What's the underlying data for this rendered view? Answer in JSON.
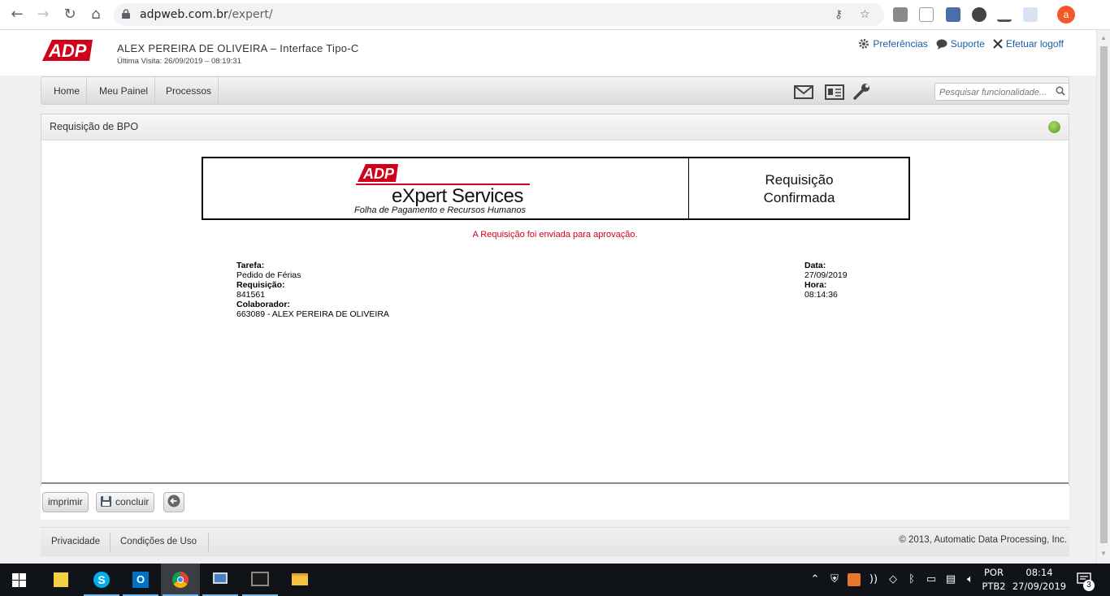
{
  "browser": {
    "url_domain": "adpweb.com.br",
    "url_path": "/expert/",
    "profile_initial": "a"
  },
  "header": {
    "user_line": "ALEX PEREIRA DE OLIVEIRA – Interface Tipo-C",
    "last_visit": "Última Visita: 26/09/2019 – 08:19:31",
    "links": {
      "preferences": "Preferências",
      "support": "Suporte",
      "logoff": "Efetuar logoff"
    }
  },
  "menu": {
    "items": [
      "Home",
      "Meu Painel",
      "Processos"
    ],
    "search_placeholder": "Pesquisar funcionalidade..."
  },
  "panel": {
    "title": "Requisição de BPO",
    "banner": {
      "brand": "eXpert Services",
      "subtitle": "Folha de Pagamento e Recursos Humanos",
      "status_line1": "Requisição",
      "status_line2": "Confirmada"
    },
    "message": "A Requisição foi enviada para aprovação.",
    "details": {
      "tarefa_label": "Tarefa:",
      "tarefa_value": "Pedido de Férias",
      "requisicao_label": "Requisição:",
      "requisicao_value": "841561",
      "colaborador_label": "Colaborador:",
      "colaborador_value": "663089 - ALEX PEREIRA DE OLIVEIRA",
      "data_label": "Data:",
      "data_value": "27/09/2019",
      "hora_label": "Hora:",
      "hora_value": "08:14:36"
    }
  },
  "actions": {
    "print": "imprimir",
    "finish": "concluir"
  },
  "footer": {
    "privacy": "Privacidade",
    "terms": "Condições de Uso",
    "copyright": "© 2013, Automatic Data Processing, Inc."
  },
  "taskbar": {
    "lang_top": "POR",
    "lang_bottom": "PTB2",
    "time": "08:14",
    "date": "27/09/2019",
    "notifications": "3"
  },
  "colors": {
    "adp_red": "#d0021b",
    "link_blue": "#1a5ea8"
  }
}
